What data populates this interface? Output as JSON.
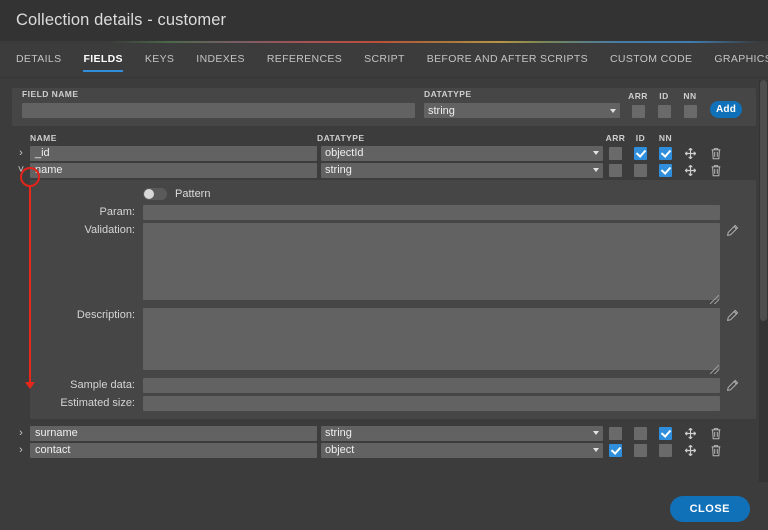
{
  "window": {
    "title": "Collection details - customer"
  },
  "tabs": [
    {
      "label": "DETAILS",
      "active": false
    },
    {
      "label": "FIELDS",
      "active": true
    },
    {
      "label": "KEYS",
      "active": false
    },
    {
      "label": "INDEXES",
      "active": false
    },
    {
      "label": "REFERENCES",
      "active": false
    },
    {
      "label": "SCRIPT",
      "active": false
    },
    {
      "label": "BEFORE AND AFTER SCRIPTS",
      "active": false
    },
    {
      "label": "CUSTOM CODE",
      "active": false
    },
    {
      "label": "GRAPHICS",
      "active": false
    }
  ],
  "new_field": {
    "name_label": "FIELD NAME",
    "name_value": "",
    "name_placeholder": "",
    "datatype_label": "DATATYPE",
    "datatype_value": "string",
    "arr_label": "ARR",
    "id_label": "ID",
    "nn_label": "NN",
    "arr_checked": false,
    "id_checked": false,
    "nn_checked": false,
    "add_label": "Add"
  },
  "table": {
    "headers": {
      "name": "NAME",
      "datatype": "DATATYPE",
      "arr": "ARR",
      "id": "ID",
      "nn": "NN"
    },
    "rows": [
      {
        "name": "_id",
        "datatype": "objectId",
        "arr": false,
        "id": true,
        "nn": true,
        "expanded": false
      },
      {
        "name": "name",
        "datatype": "string",
        "arr": false,
        "id": false,
        "nn": true,
        "expanded": true
      },
      {
        "name": "surname",
        "datatype": "string",
        "arr": false,
        "id": false,
        "nn": true,
        "expanded": false
      },
      {
        "name": "contact",
        "datatype": "object",
        "arr": true,
        "id": false,
        "nn": false,
        "expanded": false
      }
    ]
  },
  "detail_panel": {
    "pattern_label": "Pattern",
    "pattern_on": false,
    "param_label": "Param:",
    "param_value": "",
    "validation_label": "Validation:",
    "validation_value": "",
    "description_label": "Description:",
    "description_value": "",
    "sample_label": "Sample data:",
    "sample_value": "",
    "estimated_label": "Estimated size:",
    "estimated_value": ""
  },
  "footer": {
    "close_label": "CLOSE"
  },
  "icons": {
    "chevron_right": "›",
    "chevron_down": "˅"
  },
  "colors": {
    "accent_blue": "#1171b8",
    "tab_underline": "#2f8fdc",
    "checkbox_on": "#2f8fdc",
    "annotation_red": "#e8261a",
    "window_bg": "#3c3c3c",
    "panel_bg": "#464646",
    "input_bg": "#626262"
  }
}
